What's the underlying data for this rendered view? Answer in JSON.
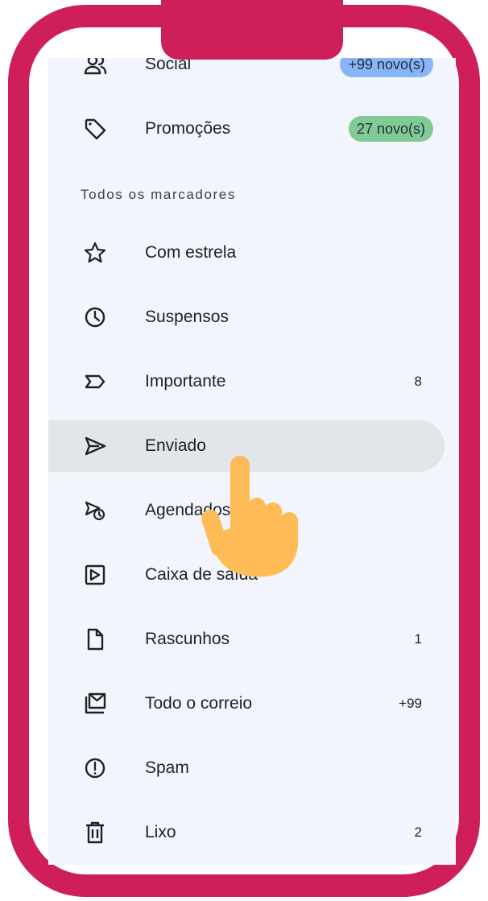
{
  "categories": [
    {
      "label": "Social",
      "badge": "+99 novo(s)",
      "badge_color": "#8ab4f8",
      "icon": "people-icon"
    },
    {
      "label": "Promoções",
      "badge": "27 novo(s)",
      "badge_color": "#81c995",
      "icon": "tag-icon"
    }
  ],
  "section_title": "Todos os marcadores",
  "labels": [
    {
      "label": "Com estrela",
      "count": "",
      "icon": "star-icon"
    },
    {
      "label": "Suspensos",
      "count": "",
      "icon": "clock-icon"
    },
    {
      "label": "Importante",
      "count": "8",
      "icon": "important-icon"
    },
    {
      "label": "Enviado",
      "count": "",
      "icon": "send-icon",
      "active": true
    },
    {
      "label": "Agendados",
      "count": "",
      "icon": "scheduled-send-icon"
    },
    {
      "label": "Caixa de saída",
      "count": "",
      "icon": "outbox-icon"
    },
    {
      "label": "Rascunhos",
      "count": "1",
      "icon": "draft-icon"
    },
    {
      "label": "Todo o correio",
      "count": "+99",
      "icon": "all-mail-icon"
    },
    {
      "label": "Spam",
      "count": "",
      "icon": "spam-icon"
    },
    {
      "label": "Lixo",
      "count": "2",
      "icon": "trash-icon"
    }
  ],
  "colors": {
    "frame": "#cf1f5a",
    "screen_bg": "#f2f6fc",
    "active_row": "#e2e6ea",
    "hand": "#ffbb55"
  }
}
